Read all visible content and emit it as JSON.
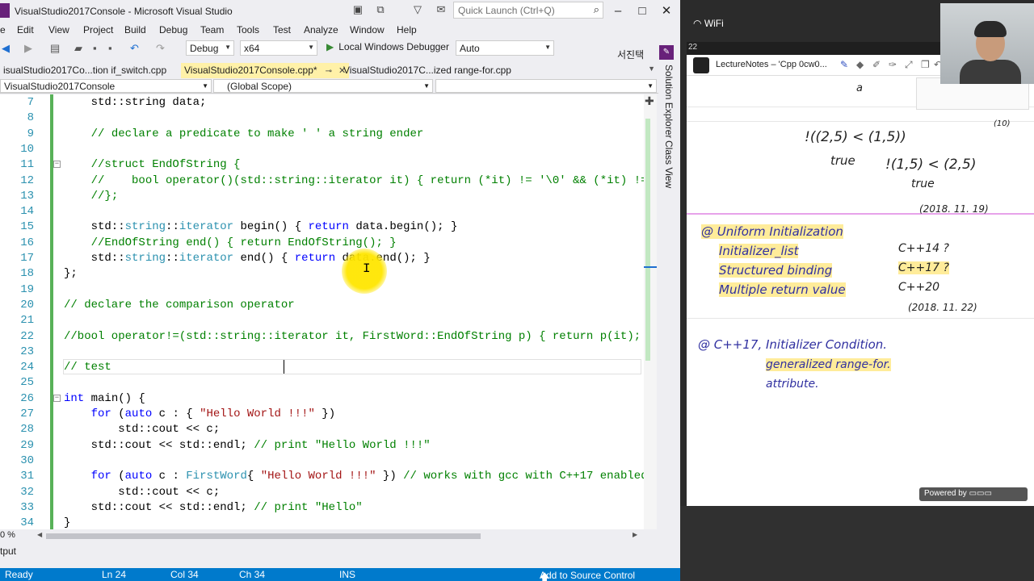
{
  "window": {
    "title": "VisualStudio2017Console - Microsoft Visual Studio",
    "quick_launch_placeholder": "Quick Launch (Ctrl+Q)",
    "user": "서진택"
  },
  "menu": [
    "e",
    "Edit",
    "View",
    "Project",
    "Build",
    "Debug",
    "Team",
    "Tools",
    "Test",
    "Analyze",
    "Window",
    "Help"
  ],
  "toolbar": {
    "config": "Debug",
    "platform": "x64",
    "run_label": "Local Windows Debugger",
    "run_mode": "Auto"
  },
  "tabs": [
    {
      "label": "isualStudio2017Co...tion if_switch.cpp",
      "active": false
    },
    {
      "label": "VisualStudio2017Console.cpp*",
      "active": true
    },
    {
      "label": "VisualStudio2017C...ized range-for.cpp",
      "active": false
    }
  ],
  "navbar": {
    "project": "VisualStudio2017Console",
    "scope": "(Global Scope)"
  },
  "code_lines": [
    {
      "n": "7",
      "html": "    std::string data;"
    },
    {
      "n": "8",
      "html": ""
    },
    {
      "n": "9",
      "html": "    <span class='c-com'>// declare a predicate to make ' ' a string ender</span>"
    },
    {
      "n": "10",
      "html": ""
    },
    {
      "n": "11",
      "html": "    <span class='c-com'>//struct EndOfString {</span>",
      "fold": "−"
    },
    {
      "n": "12",
      "html": "    <span class='c-com'>//    bool operator()(std::string::iterator it) { return (*it) != '\\0' &amp;&amp; (*it) !=</span>"
    },
    {
      "n": "13",
      "html": "    <span class='c-com'>//};</span>"
    },
    {
      "n": "14",
      "html": ""
    },
    {
      "n": "15",
      "html": "    std::<span class='c-type'>string</span>::<span class='c-type'>iterator</span> begin() { <span class='c-kw'>return</span> data.begin(); }"
    },
    {
      "n": "16",
      "html": "    <span class='c-com'>//EndOfString end() { return EndOfString(); }</span>"
    },
    {
      "n": "17",
      "html": "    std::<span class='c-type'>string</span>::<span class='c-type'>iterator</span> end() { <span class='c-kw'>return</span> data.end(); }"
    },
    {
      "n": "18",
      "html": "};"
    },
    {
      "n": "19",
      "html": ""
    },
    {
      "n": "20",
      "html": "<span class='c-com'>// declare the comparison operator</span>"
    },
    {
      "n": "21",
      "html": ""
    },
    {
      "n": "22",
      "html": "<span class='c-com'>//bool operator!=(std::string::iterator it, FirstWord::EndOfString p) { return p(it); }</span>"
    },
    {
      "n": "23",
      "html": ""
    },
    {
      "n": "24",
      "html": "<span class='c-com'>// test</span>"
    },
    {
      "n": "25",
      "html": ""
    },
    {
      "n": "26",
      "html": "<span class='c-kw'>int</span> main() {",
      "fold": "−"
    },
    {
      "n": "27",
      "html": "    <span class='c-kw'>for</span> (<span class='c-kw'>auto</span> c : { <span class='c-str'>\"Hello World !!!\"</span> })"
    },
    {
      "n": "28",
      "html": "        std::cout &lt;&lt; c;"
    },
    {
      "n": "29",
      "html": "    std::cout &lt;&lt; std::endl; <span class='c-com'>// print \"Hello World !!!\"</span>"
    },
    {
      "n": "30",
      "html": ""
    },
    {
      "n": "31",
      "html": "    <span class='c-kw'>for</span> (<span class='c-kw'>auto</span> c : <span class='c-type'>FirstWord</span>{ <span class='c-str'>\"Hello World !!!\"</span> }) <span class='c-com'>// works with gcc with C++17 enabled</span>"
    },
    {
      "n": "32",
      "html": "        std::cout &lt;&lt; c;"
    },
    {
      "n": "33",
      "html": "    std::cout &lt;&lt; std::endl; <span class='c-com'>// print \"Hello\"</span>"
    },
    {
      "n": "34",
      "html": "}"
    }
  ],
  "editor": {
    "zoom": "0 %"
  },
  "side_tabs": [
    "Solution Explorer",
    "Class View"
  ],
  "output_tab": "tput",
  "status": {
    "ready": "Ready",
    "ln": "Ln 24",
    "col": "Col 34",
    "ch": "Ch 34",
    "ins": "INS",
    "source_control": "Add to Source Control"
  },
  "notes": {
    "wifi": "WiFi",
    "clock": "22",
    "app_title": "LectureNotes – 'Cpp 0cw0...",
    "powered": "Powered by",
    "handwriting": [
      {
        "text": "a",
        "size": 13
      },
      {
        "text": "!((2,5) < (1,5))",
        "size": 18
      },
      {
        "text": "(10)",
        "size": 10
      },
      {
        "text": "true",
        "size": 15
      },
      {
        "text": "!(1,5) < (2,5)",
        "size": 18
      },
      {
        "text": "true",
        "size": 15
      },
      {
        "text": "(2018. 11. 19)",
        "size": 12
      },
      {
        "text": "@ Uniform Initialization",
        "size": 15
      },
      {
        "text": "Initializer_list",
        "size": 15
      },
      {
        "text": "Structured binding",
        "size": 15
      },
      {
        "text": "Multiple return value",
        "size": 15
      },
      {
        "text": "C++14 ?",
        "size": 14
      },
      {
        "text": "C++17 ?",
        "size": 14
      },
      {
        "text": "C++20",
        "size": 14
      },
      {
        "text": "(2018. 11. 22)",
        "size": 12
      },
      {
        "text": "@ C++17,  Initializer Condition.",
        "size": 15
      },
      {
        "text": "generalized range-for.",
        "size": 14
      },
      {
        "text": "attribute.",
        "size": 14
      }
    ]
  }
}
